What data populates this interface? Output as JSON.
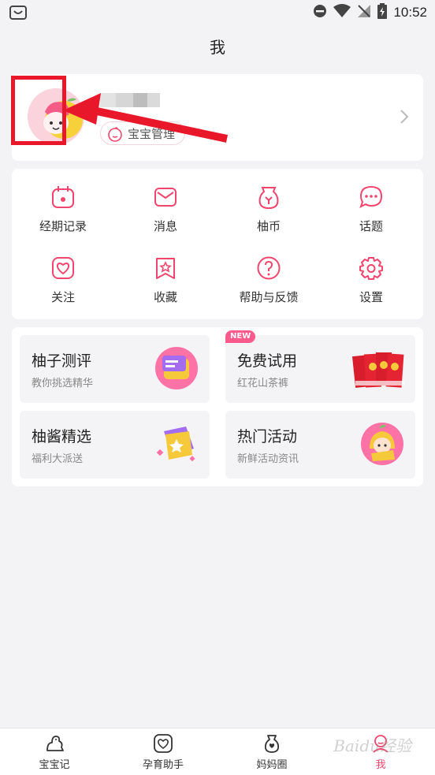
{
  "status_bar": {
    "time": "10:52"
  },
  "header": {
    "title": "我"
  },
  "profile": {
    "baby_management_label": "宝宝管理"
  },
  "menu": {
    "items": [
      {
        "label": "经期记录",
        "icon": "calendar-icon"
      },
      {
        "label": "消息",
        "icon": "envelope-icon"
      },
      {
        "label": "柚币",
        "icon": "coin-pouch-icon"
      },
      {
        "label": "话题",
        "icon": "chat-bubble-icon"
      },
      {
        "label": "关注",
        "icon": "heart-icon"
      },
      {
        "label": "收藏",
        "icon": "star-bookmark-icon"
      },
      {
        "label": "帮助与反馈",
        "icon": "question-icon"
      },
      {
        "label": "设置",
        "icon": "gear-icon"
      }
    ]
  },
  "features": {
    "cards": [
      {
        "title": "柚子测评",
        "subtitle": "教你挑选精华"
      },
      {
        "title": "免费试用",
        "subtitle": "红花山茶裤",
        "badge": "NEW"
      },
      {
        "title": "柚酱精选",
        "subtitle": "福利大派送"
      },
      {
        "title": "热门活动",
        "subtitle": "新鲜活动资讯"
      }
    ]
  },
  "bottom_nav": {
    "items": [
      {
        "label": "宝宝记",
        "active": false
      },
      {
        "label": "孕育助手",
        "active": false
      },
      {
        "label": "妈妈圈",
        "active": false
      },
      {
        "label": "我",
        "active": true
      }
    ]
  },
  "watermark": "Baidu经验",
  "colors": {
    "accent": "#f0466e",
    "annotation": "#e8182a"
  }
}
